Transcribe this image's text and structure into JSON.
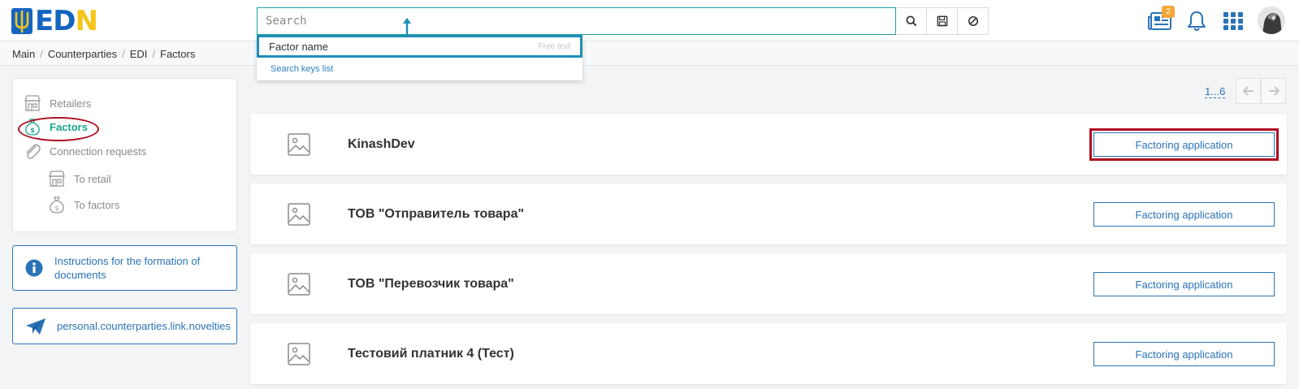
{
  "brand": {
    "logo_text": "EDIN"
  },
  "search": {
    "placeholder": "Search"
  },
  "header": {
    "notifications_badge": "2"
  },
  "breadcrumb": [
    "Main",
    "Counterparties",
    "EDI",
    "Factors"
  ],
  "dropdown": {
    "item_name": "Factor name",
    "item_hint": "Free text",
    "link": "Search keys list"
  },
  "sidebar": {
    "items": [
      {
        "label": "Retailers",
        "icon": "store-icon"
      },
      {
        "label": "Factors",
        "icon": "money-bag-icon",
        "active": true
      },
      {
        "label": "Connection requests",
        "icon": "paperclip-icon"
      },
      {
        "label": "To retail",
        "icon": "store-icon"
      },
      {
        "label": "To factors",
        "icon": "money-bag-icon"
      }
    ],
    "instructions": "Instructions for the formation of documents",
    "novelties": "personal.counterparties.link.novelties"
  },
  "pager": {
    "range": "1...6"
  },
  "factors": [
    {
      "name": "KinashDev",
      "action": "Factoring application"
    },
    {
      "name": "ТОВ \"Отправитель товара\"",
      "action": "Factoring application"
    },
    {
      "name": "ТОВ \"Перевозчик товара\"",
      "action": "Factoring application"
    },
    {
      "name": "Тестовий платник 4 (Тест)",
      "action": "Factoring application"
    }
  ],
  "colors": {
    "accent": "#2a73b8",
    "active": "#18a58d",
    "highlight": "#b00e23",
    "search_border": "#1fa1a1"
  }
}
